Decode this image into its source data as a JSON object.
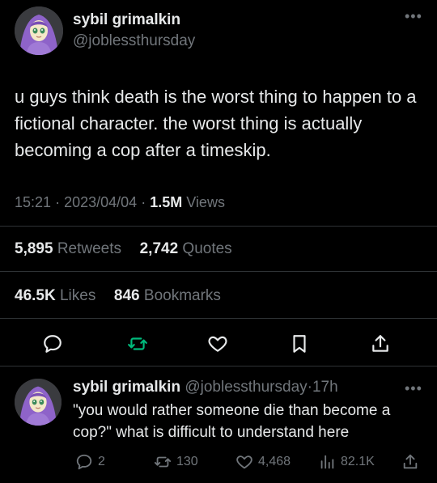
{
  "main_tweet": {
    "author_name": "sybil grimalkin",
    "author_handle": "@joblessthursday",
    "more_icon": "more-horizontal-icon",
    "text": "u guys think death is the worst thing to happen to a fictional character. the worst thing is actually becoming a cop after a timeskip.",
    "time": "15:21",
    "separator": "·",
    "date": "2023/04/04",
    "views_count": "1.5M",
    "views_label": "Views",
    "retweets_count": "5,895",
    "retweets_label": "Retweets",
    "quotes_count": "2,742",
    "quotes_label": "Quotes",
    "likes_count": "46.5K",
    "likes_label": "Likes",
    "bookmarks_count": "846",
    "bookmarks_label": "Bookmarks",
    "actions": [
      "reply-icon",
      "retweet-icon",
      "like-icon",
      "bookmark-icon",
      "share-icon"
    ]
  },
  "reply_tweet": {
    "author_name": "sybil grimalkin",
    "author_handle": "@joblessthursday",
    "separator": "·",
    "time_ago": "17h",
    "text": "\"you would rather someone die than become a cop?\" what is difficult to understand here",
    "reply_count": "2",
    "retweet_count": "130",
    "like_count": "4,468",
    "view_count": "82.1K"
  },
  "colors": {
    "background": "#000000",
    "text": "#e7e9ea",
    "muted": "#71767b",
    "retweet_accent": "#00ba7c",
    "divider": "#2f3336",
    "avatar_hijab": "#8e63c9"
  }
}
